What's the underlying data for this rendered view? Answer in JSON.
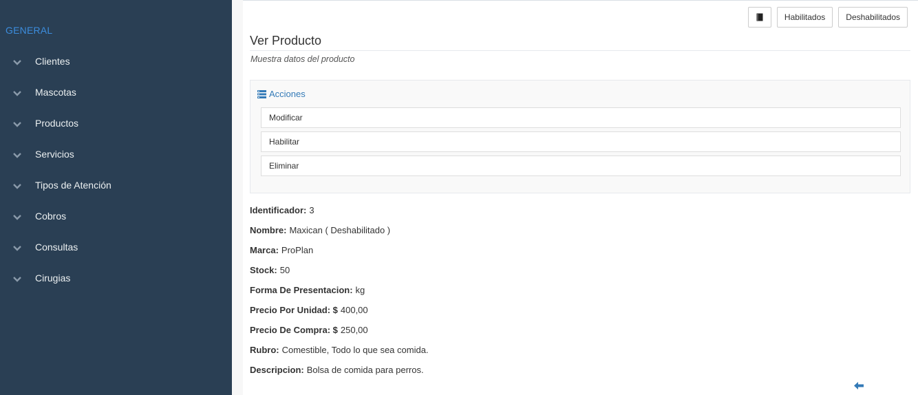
{
  "sidebar": {
    "section_title": "GENERAL",
    "items": [
      {
        "label": "Clientes"
      },
      {
        "label": "Mascotas"
      },
      {
        "label": "Productos"
      },
      {
        "label": "Servicios"
      },
      {
        "label": "Tipos de Atención"
      },
      {
        "label": "Cobros"
      },
      {
        "label": "Consultas"
      },
      {
        "label": "Cirugias"
      }
    ]
  },
  "toolbar": {
    "book_icon": "book-icon",
    "habilitados_label": "Habilitados",
    "deshabilitados_label": "Deshabilitados"
  },
  "page": {
    "title": "Ver Producto",
    "subtitle": "Muestra datos del producto"
  },
  "actions": {
    "heading": "Acciones",
    "items": [
      {
        "label": "Modificar"
      },
      {
        "label": "Habilitar"
      },
      {
        "label": "Eliminar"
      }
    ]
  },
  "details": [
    {
      "label": "Identificador:",
      "value": "3"
    },
    {
      "label": "Nombre:",
      "value": "Maxican ( Deshabilitado )"
    },
    {
      "label": "Marca:",
      "value": "ProPlan"
    },
    {
      "label": "Stock:",
      "value": "50"
    },
    {
      "label": "Forma De Presentacion:",
      "value": "kg"
    },
    {
      "label": "Precio Por Unidad: $",
      "value": "400,00"
    },
    {
      "label": "Precio De Compra: $",
      "value": "250,00"
    },
    {
      "label": "Rubro:",
      "value": "Comestible, Todo lo que sea comida."
    },
    {
      "label": "Descripcion:",
      "value": "Bolsa de comida para perros."
    }
  ],
  "colors": {
    "sidebar_bg": "#2a3f54",
    "section_title": "#3c8dde",
    "link": "#337ab7"
  }
}
